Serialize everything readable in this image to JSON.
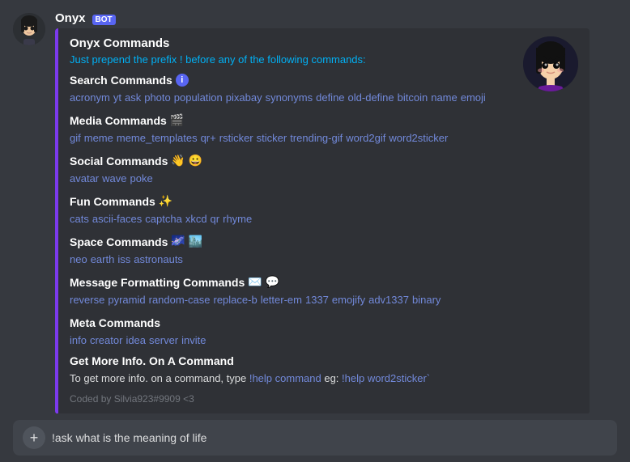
{
  "chat": {
    "bot_name": "Onyx",
    "bot_tag": "BOT",
    "embed": {
      "title": "Onyx Commands",
      "subtitle": "Just prepend the prefix ! before any of the following commands:",
      "sections": [
        {
          "id": "search",
          "heading": "Search Commands",
          "icon": "ℹ️",
          "icon_type": "info",
          "commands": "acronym  yt  ask  photo  population  pixabay  synonyms  define  old-define  bitcoin  name  emoji"
        },
        {
          "id": "media",
          "heading": "Media Commands",
          "icon": "🎬",
          "icon_type": "emoji",
          "commands": "gif  meme  meme_templates  qr+  rsticker  sticker  trending-gif  word2gif  word2sticker"
        },
        {
          "id": "social",
          "heading": "Social Commands",
          "icon": "👋😀",
          "icon_type": "emoji",
          "commands": "avatar  wave  poke"
        },
        {
          "id": "fun",
          "heading": "Fun Commands",
          "icon": "✨",
          "icon_type": "emoji",
          "commands": "cats  ascii-faces  captcha  xkcd  qr  rhyme"
        },
        {
          "id": "space",
          "heading": "Space Commands",
          "icon": "🌌🏙️",
          "icon_type": "emoji",
          "commands": "neo  earth  iss  astronauts"
        },
        {
          "id": "message",
          "heading": "Message Formatting Commands",
          "icon": "✉️💬",
          "icon_type": "emoji",
          "commands": "reverse  pyramid  random-case  replace-b  letter-em  1337  emojify  adv1337  binary"
        },
        {
          "id": "meta",
          "heading": "Meta Commands",
          "icon": "",
          "icon_type": "none",
          "commands": "info  creator  idea  server  invite"
        }
      ],
      "get_more": {
        "title": "Get More Info. On A Command",
        "text_before": "To get more info. on a command, type ",
        "highlight": "!help command",
        "text_middle": " eg: ",
        "example": "!help word2sticker",
        "text_suffix": ""
      },
      "coded_by": "Coded by Silvia923#9909 <3"
    }
  },
  "input": {
    "placeholder": "!ask what is the meaning of life",
    "plus_label": "+"
  }
}
